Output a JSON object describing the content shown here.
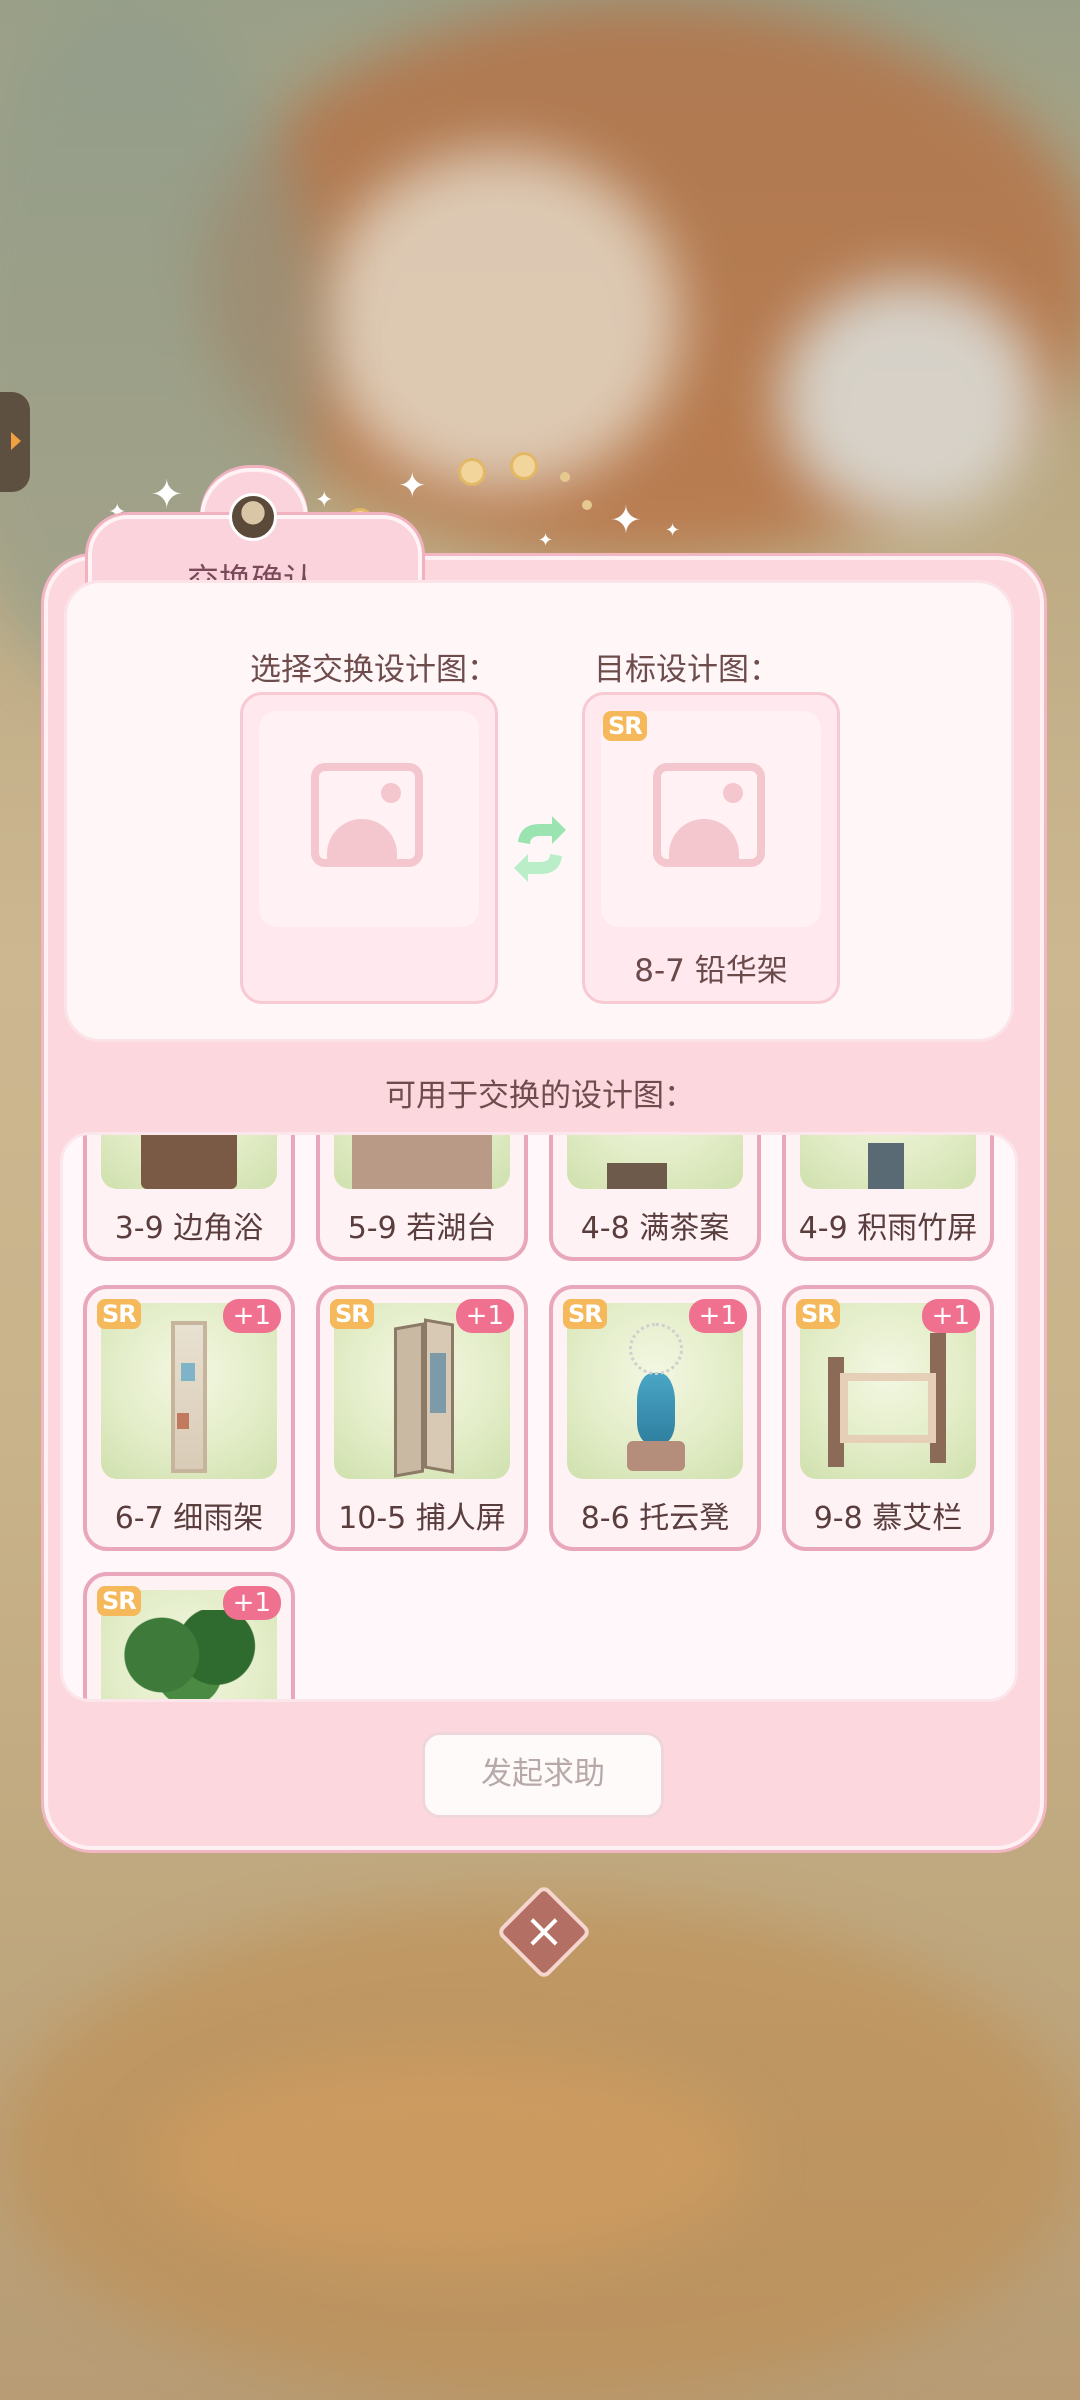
{
  "dialog": {
    "title": "交换确认",
    "select_label": "选择交换设计图：",
    "target_label": "目标设计图：",
    "target_item": {
      "rarity": "SR",
      "name": "8-7 铅华架"
    },
    "available_label": "可用于交换的设计图：",
    "items_partial_row": [
      {
        "name": "3-9 边角浴"
      },
      {
        "name": "5-9 若湖台"
      },
      {
        "name": "4-8 满茶案"
      },
      {
        "name": "4-9 积雨竹屏"
      }
    ],
    "items": [
      {
        "rarity": "SR",
        "count": "+1",
        "name": "6-7 细雨架",
        "icon": "shelf-icon"
      },
      {
        "rarity": "SR",
        "count": "+1",
        "name": "10-5 捕人屏",
        "icon": "screen-icon"
      },
      {
        "rarity": "SR",
        "count": "+1",
        "name": "8-6 托云凳",
        "icon": "vase-icon"
      },
      {
        "rarity": "SR",
        "count": "+1",
        "name": "9-8 慕艾栏",
        "icon": "railing-icon"
      },
      {
        "rarity": "SR",
        "count": "+1",
        "name": "",
        "icon": "bonsai-tree-icon"
      }
    ],
    "help_button": "发起求助"
  },
  "colors": {
    "accent": "#fcd7de",
    "border": "#e8a7bb",
    "sr_badge": "#f5b85a",
    "plus_badge": "#f07090"
  }
}
